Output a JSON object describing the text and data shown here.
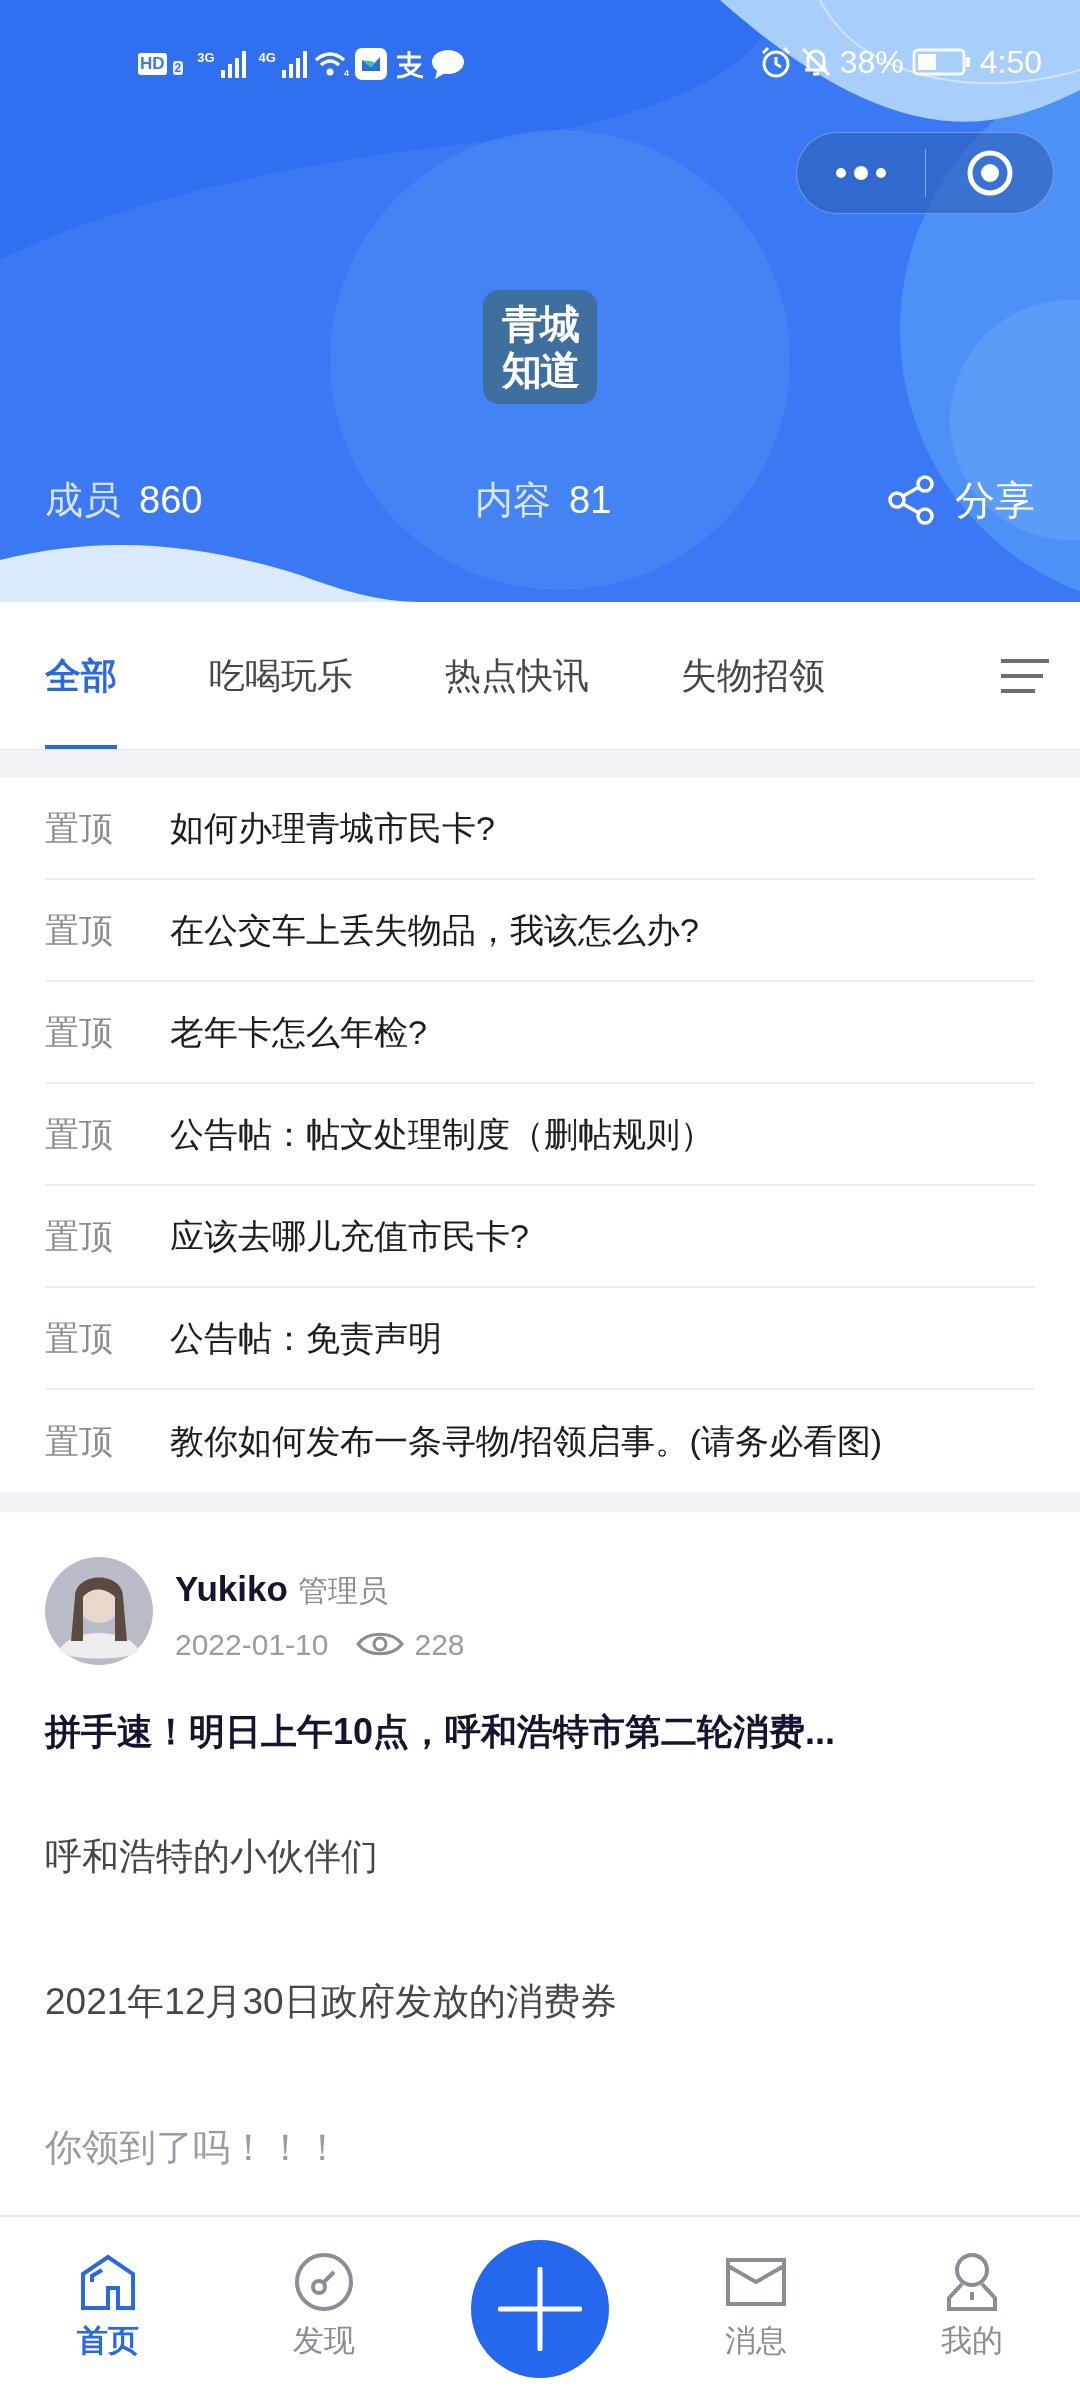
{
  "status_bar": {
    "hd": "HD",
    "sim": "2",
    "net_1": "3G",
    "net_2": "4G",
    "wifi_badge": "4",
    "battery": "38%",
    "time": "4:50"
  },
  "header": {
    "logo_lines": [
      "青城",
      "知道"
    ],
    "stats": [
      {
        "label": "成员",
        "value": "860"
      },
      {
        "label": "内容",
        "value": "81"
      }
    ],
    "share": "分享"
  },
  "tabs": [
    {
      "label": "全部",
      "selected": true
    },
    {
      "label": "吃喝玩乐",
      "selected": false
    },
    {
      "label": "热点快讯",
      "selected": false
    },
    {
      "label": "失物招领",
      "selected": false
    }
  ],
  "pinned": [
    {
      "tag": "置顶",
      "title": "如何办理青城市民卡?"
    },
    {
      "tag": "置顶",
      "title": "在公交车上丢失物品，我该怎么办?"
    },
    {
      "tag": "置顶",
      "title": "老年卡怎么年检?"
    },
    {
      "tag": "置顶",
      "title": "公告帖：帖文处理制度（删帖规则）"
    },
    {
      "tag": "置顶",
      "title": "应该去哪儿充值市民卡?"
    },
    {
      "tag": "置顶",
      "title": "公告帖：免责声明"
    },
    {
      "tag": "置顶",
      "title": "教你如何发布一条寻物/招领启事。(请务必看图)"
    }
  ],
  "post": {
    "author": "Yukiko",
    "role": "管理员",
    "date": "2022-01-10",
    "views": "228",
    "title": "拼手速！明日上午10点，呼和浩特市第二轮消费...",
    "paragraphs": [
      "呼和浩特的小伙伴们",
      "2021年12月30日政府发放的消费券",
      "你领到了吗！！！"
    ]
  },
  "bottom_nav": [
    {
      "kind": "home",
      "label": "首页",
      "selected": true
    },
    {
      "kind": "discover",
      "label": "发现",
      "selected": false
    },
    {
      "kind": "add"
    },
    {
      "kind": "messages",
      "label": "消息",
      "selected": false
    },
    {
      "kind": "profile",
      "label": "我的",
      "selected": false
    }
  ]
}
